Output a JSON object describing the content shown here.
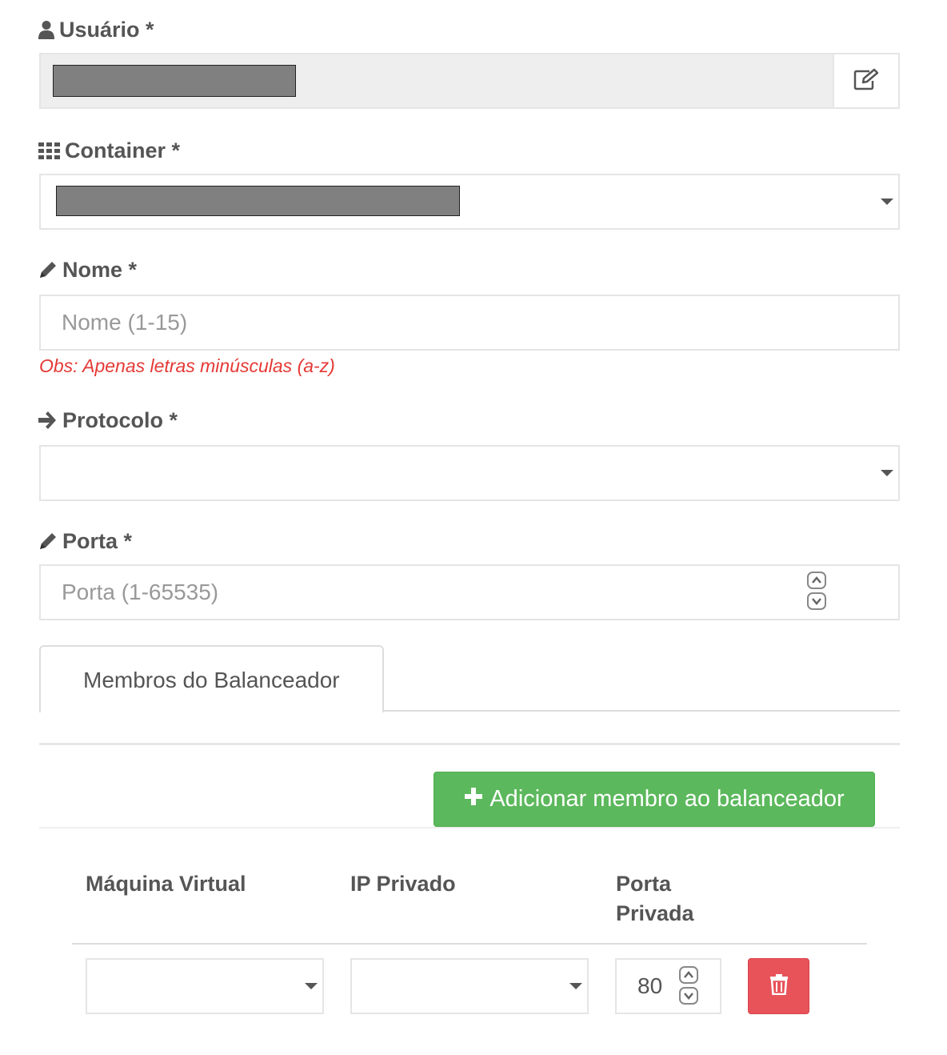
{
  "fields": {
    "usuario": {
      "label": "Usuário *",
      "icon": "user-icon",
      "edit_icon": "edit-icon"
    },
    "container": {
      "label": "Container *",
      "icon": "th-grid-icon"
    },
    "nome": {
      "label": "Nome *",
      "icon": "pencil-icon",
      "placeholder": "Nome (1-15)",
      "note": "Obs: Apenas letras minúsculas (a-z)"
    },
    "protocolo": {
      "label": "Protocolo *",
      "icon": "arrow-right-icon",
      "value": ""
    },
    "porta": {
      "label": "Porta *",
      "icon": "pencil-icon",
      "placeholder": "Porta (1-65535)"
    }
  },
  "tabs": [
    {
      "label": "Membros do Balanceador",
      "active": true
    }
  ],
  "members": {
    "add_button": "Adicionar membro ao balanceador",
    "add_icon": "plus-icon",
    "columns": {
      "vm": "Máquina Virtual",
      "ip": "IP Privado",
      "port_line1": "Porta",
      "port_line2": "Privada"
    },
    "rows": [
      {
        "vm": "",
        "ip": "",
        "port": "80",
        "delete_icon": "trash-icon"
      }
    ]
  },
  "colors": {
    "success": "#5cb85c",
    "danger": "#e8535a",
    "note": "#e53935",
    "text": "#555555"
  }
}
